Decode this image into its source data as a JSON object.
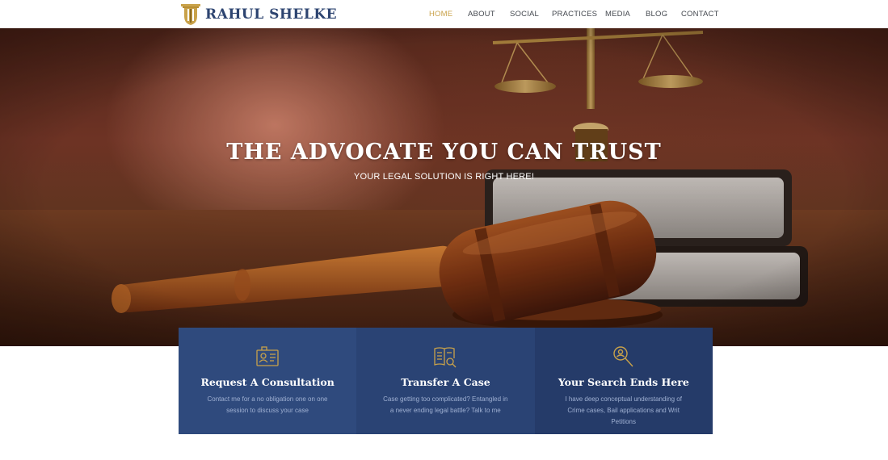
{
  "brand": {
    "name": "RAHUL SHELKE",
    "logo_icon": "pillar-icon",
    "color": "#2d4470",
    "accent": "#c9a24a"
  },
  "nav": {
    "items": [
      {
        "label": "HOME",
        "active": true
      },
      {
        "label": "ABOUT",
        "active": false
      },
      {
        "label": "SOCIAL",
        "active": false
      },
      {
        "label": "PRACTICES",
        "active": false
      },
      {
        "label": "MEDIA",
        "active": false
      },
      {
        "label": "BLOG",
        "active": false
      },
      {
        "label": "CONTACT",
        "active": false
      }
    ]
  },
  "hero": {
    "title": "THE ADVOCATE YOU CAN TRUST",
    "subtitle": "YOUR LEGAL SOLUTION IS RIGHT HERE!"
  },
  "features": [
    {
      "icon": "id-card-icon",
      "title": "Request A Consultation",
      "description": "Contact me for a no obligation one on one session to discuss your case"
    },
    {
      "icon": "book-search-icon",
      "title": "Transfer A Case",
      "description": "Case getting too complicated? Entangled in a never ending legal battle? Talk to me"
    },
    {
      "icon": "magnifier-person-icon",
      "title": "Your Search Ends Here",
      "description": "I have deep conceptual understanding of Crime cases, Bail applications and Writ Petitions"
    }
  ]
}
